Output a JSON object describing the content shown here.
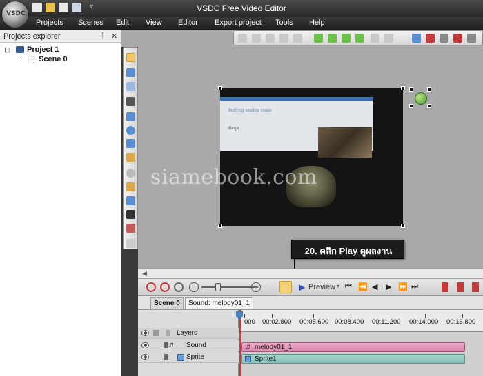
{
  "window": {
    "title": "VSDC Free Video Editor",
    "logo_text": "VSDC"
  },
  "menu": [
    "Projects",
    "Scenes",
    "Edit",
    "View",
    "Editor",
    "Export project",
    "Tools",
    "Help"
  ],
  "explorer": {
    "title": "Projects explorer",
    "pin_glyph": "†",
    "close_glyph": "✕",
    "project_label": "Project 1",
    "scene_label": "Scene 0",
    "expand_glyph": "⊟"
  },
  "canvas": {
    "watermark": "siamebook.com",
    "screen_text1": "BullFrog swallow snake",
    "screen_text2": "ข้อมูล"
  },
  "callout": {
    "text": "20. คลิก Play ดูผลงาน"
  },
  "timeline": {
    "preview_label": "Preview",
    "tabs": [
      "Scene 0",
      "Sound: melody01_1"
    ],
    "layers_label": "Layers",
    "tracks": [
      {
        "label": "Sound",
        "icon": "music-note-icon"
      },
      {
        "label": "Sprite",
        "icon": "sprite-icon"
      }
    ],
    "ruler_labels": [
      "000",
      "00:02.800",
      "00:05.600",
      "00:08.400",
      "00:11.200",
      "00:14.000",
      "00:16.800"
    ],
    "clips": {
      "sound": "melody01_1",
      "sprite": "Sprite1"
    }
  }
}
